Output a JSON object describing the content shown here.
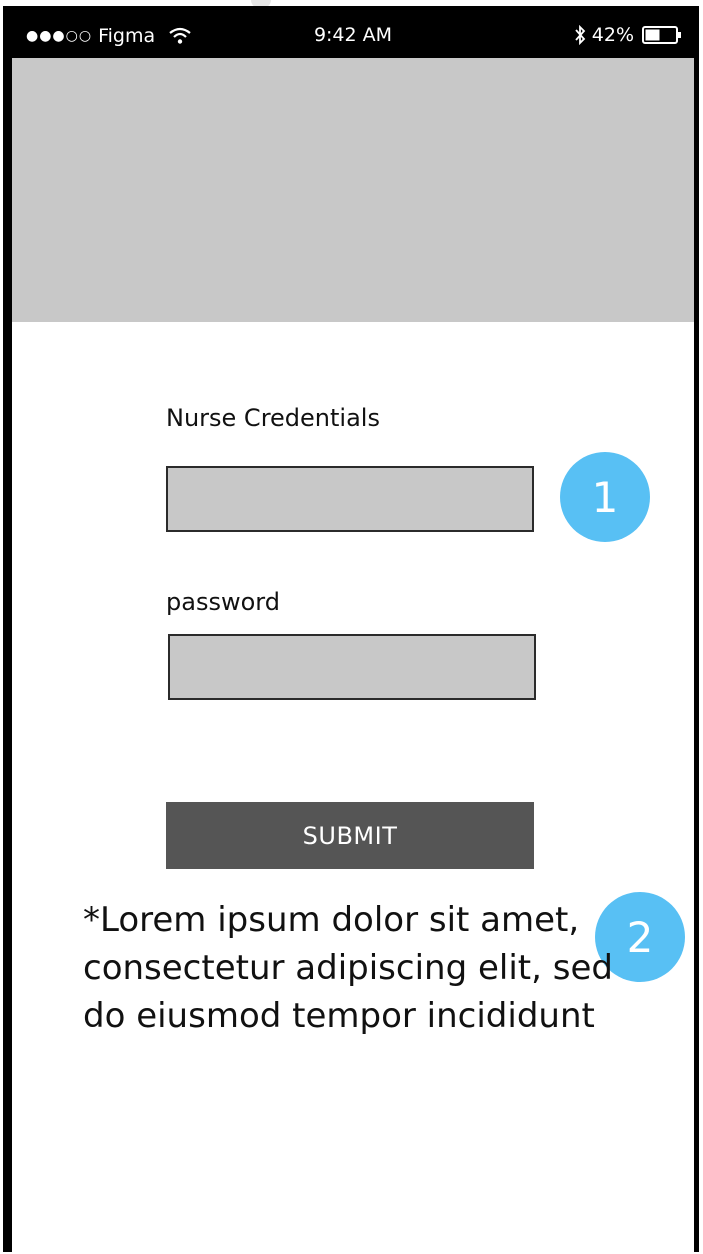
{
  "status_bar": {
    "signal": "●●●○○",
    "carrier": "Figma",
    "time": "9:42 AM",
    "battery_percent": "42%",
    "icons": [
      "wifi-icon",
      "bluetooth-icon",
      "battery-icon"
    ],
    "battery_level": 0.42
  },
  "form": {
    "credentials_label": "Nurse Credentials",
    "credentials_value": "",
    "password_label": "password",
    "password_value": "",
    "submit_label": "SUBMIT"
  },
  "annotations": {
    "badge_1": "1",
    "badge_2": "2",
    "note_text": "*Lorem ipsum dolor sit amet, consectetur adipiscing elit, sed do eiusmod tempor incididunt"
  },
  "colors": {
    "status_bar_bg": "#000000",
    "placeholder_gray": "#c8c8c8",
    "button_bg": "#555555",
    "badge_blue": "#58c0f4"
  }
}
